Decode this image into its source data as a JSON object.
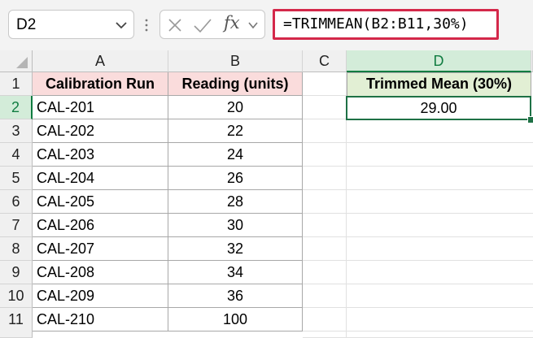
{
  "name_box": {
    "value": "D2"
  },
  "formula_bar": {
    "formula": "=TRIMMEAN(B2:B11,30%)",
    "fx_label": "fx"
  },
  "columns": [
    "A",
    "B",
    "C",
    "D"
  ],
  "rows": [
    "1",
    "2",
    "3",
    "4",
    "5",
    "6",
    "7",
    "8",
    "9",
    "10",
    "11"
  ],
  "headers": {
    "a1": "Calibration Run",
    "b1": "Reading (units)",
    "d1": "Trimmed Mean (30%)"
  },
  "data_rows": [
    {
      "run": "CAL-201",
      "reading": "20"
    },
    {
      "run": "CAL-202",
      "reading": "22"
    },
    {
      "run": "CAL-203",
      "reading": "24"
    },
    {
      "run": "CAL-204",
      "reading": "26"
    },
    {
      "run": "CAL-205",
      "reading": "28"
    },
    {
      "run": "CAL-206",
      "reading": "30"
    },
    {
      "run": "CAL-207",
      "reading": "32"
    },
    {
      "run": "CAL-208",
      "reading": "34"
    },
    {
      "run": "CAL-209",
      "reading": "36"
    },
    {
      "run": "CAL-210",
      "reading": "100"
    }
  ],
  "result": {
    "d2": "29.00"
  },
  "colors": {
    "formula_highlight": "#d4284a",
    "selection": "#1e7145",
    "header_a_b_fill": "#fadcdc",
    "header_d_fill": "#e2efd4"
  }
}
